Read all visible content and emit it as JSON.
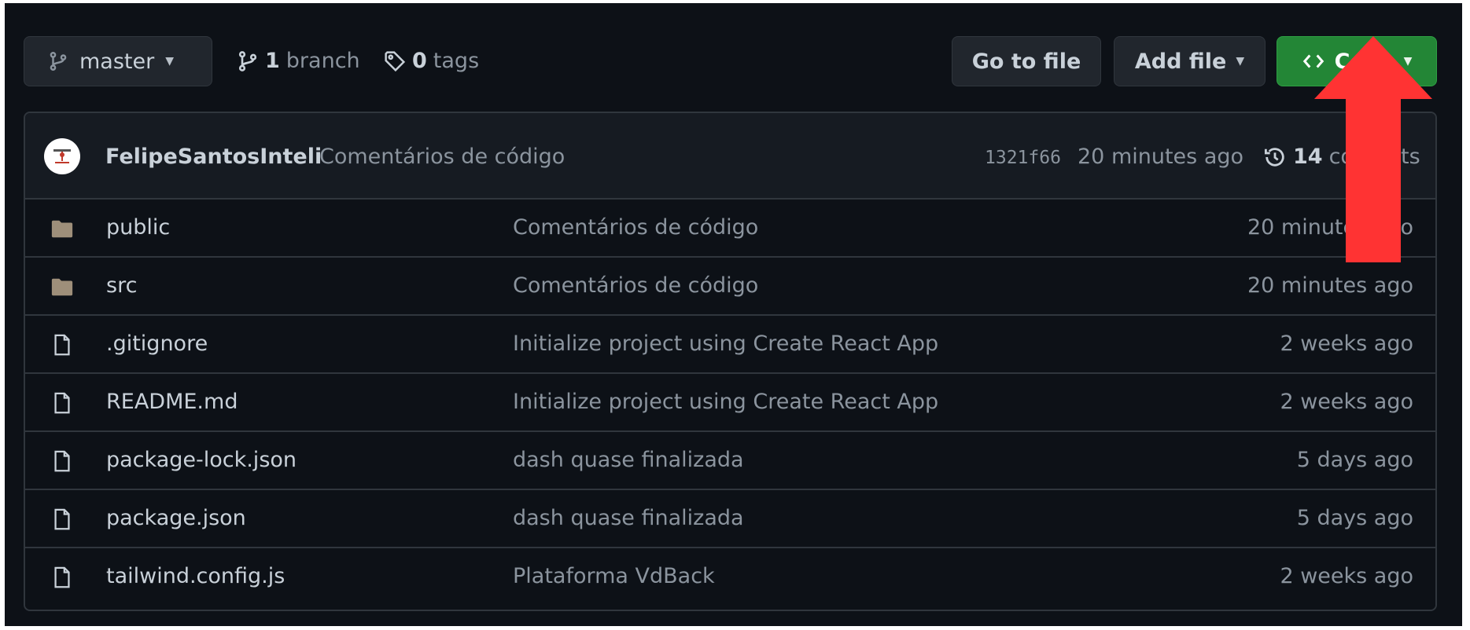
{
  "topbar": {
    "branch_button": {
      "label": "master"
    },
    "branches": {
      "count": "1",
      "label": "branch"
    },
    "tags": {
      "count": "0",
      "label": "tags"
    },
    "go_to_file": "Go to file",
    "add_file": "Add file",
    "code": "Code"
  },
  "latest_commit": {
    "author": "FelipeSantosInteli",
    "message": "Comentários de código",
    "sha": "1321f66",
    "time": "20 minutes ago",
    "commits_count": "14",
    "commits_label": "commits"
  },
  "files": [
    {
      "type": "folder",
      "name": "public",
      "message": "Comentários de código",
      "time": "20 minutes ago"
    },
    {
      "type": "folder",
      "name": "src",
      "message": "Comentários de código",
      "time": "20 minutes ago"
    },
    {
      "type": "file",
      "name": ".gitignore",
      "message": "Initialize project using Create React App",
      "time": "2 weeks ago"
    },
    {
      "type": "file",
      "name": "README.md",
      "message": "Initialize project using Create React App",
      "time": "2 weeks ago"
    },
    {
      "type": "file",
      "name": "package-lock.json",
      "message": "dash quase finalizada",
      "time": "5 days ago"
    },
    {
      "type": "file",
      "name": "package.json",
      "message": "dash quase finalizada",
      "time": "5 days ago"
    },
    {
      "type": "file",
      "name": "tailwind.config.js",
      "message": "Plataforma VdBack",
      "time": "2 weeks ago"
    }
  ],
  "colors": {
    "background": "#0d1117",
    "header": "#161b22",
    "border": "#30363d",
    "code_button": "#238636",
    "annotation_arrow": "#ff3333"
  }
}
